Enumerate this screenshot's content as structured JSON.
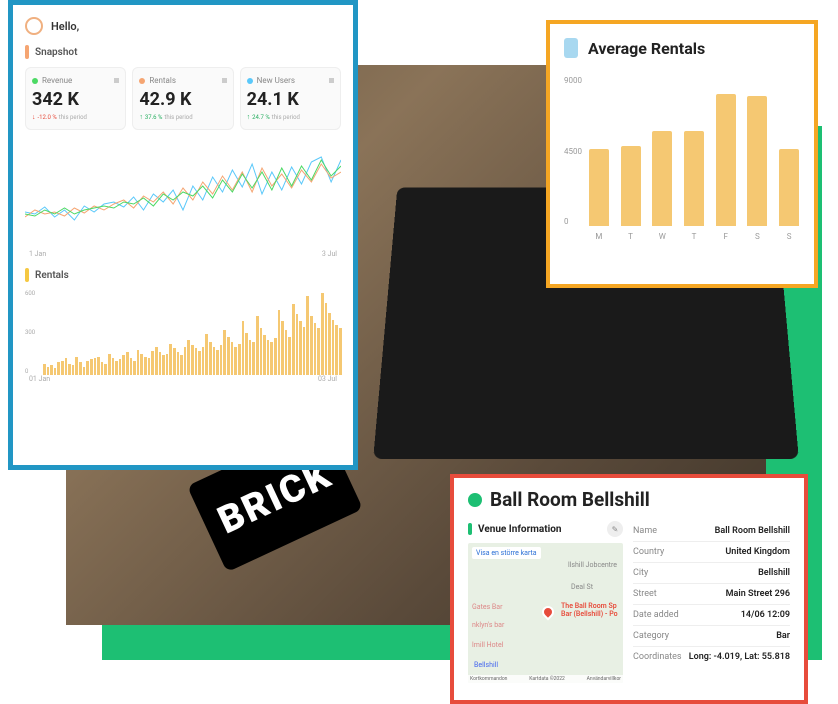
{
  "greeting": "Hello,",
  "dashboard": {
    "snapshot_label": "Snapshot",
    "rentals_section_label": "Rentals",
    "stats": [
      {
        "label": "Revenue",
        "value": "342 K",
        "change": "-12.0 %",
        "direction": "down",
        "period": "this period",
        "dot": "green"
      },
      {
        "label": "Rentals",
        "value": "42.9 K",
        "change": "37.6 %",
        "direction": "up",
        "period": "this period",
        "dot": "orange"
      },
      {
        "label": "New Users",
        "value": "24.1 K",
        "change": "24.7 %",
        "direction": "up",
        "period": "this period",
        "dot": "blue"
      }
    ],
    "line_dates": {
      "start": "1 Jan",
      "end": "3 Jul"
    },
    "rentals_dates": {
      "start": "01 Jan",
      "end": "03 Jul"
    },
    "rentals_y": [
      "600",
      "300",
      "0"
    ]
  },
  "avg": {
    "title": "Average Rentals",
    "y": [
      "9000",
      "4500",
      "0"
    ]
  },
  "venue": {
    "title": "Ball Room Bellshill",
    "info_label": "Venue Information",
    "map_link": "Visa en större karta",
    "map_pin_label": "The Ball Room Sp\nBar (Bellshill) - Po",
    "map_places": {
      "top": "llshill Jobcentre",
      "gate": "Gates Bar",
      "nklyn": "nklyn's bar",
      "hotel": "lmill Hotel",
      "bellshill": "Bellshill",
      "deal": "Deal St"
    },
    "map_attr": {
      "left": "Kortkommandon",
      "mid": "Kartdata ©2022",
      "right": "Användarvillkor"
    },
    "fields": [
      {
        "label": "Name",
        "value": "Ball Room Bellshill"
      },
      {
        "label": "Country",
        "value": "United Kingdom"
      },
      {
        "label": "City",
        "value": "Bellshill"
      },
      {
        "label": "Street",
        "value": "Main Street 296"
      },
      {
        "label": "Date added",
        "value": "14/06 12:09"
      },
      {
        "label": "Category",
        "value": "Bar"
      },
      {
        "label": "Coordinates",
        "value": "Long: -4.019, Lat: 55.818"
      }
    ]
  },
  "brick_text": "BRICK",
  "chart_data": [
    {
      "type": "bar",
      "title": "Average Rentals",
      "categories": [
        "M",
        "T",
        "W",
        "T",
        "F",
        "S",
        "S"
      ],
      "values": [
        4600,
        4800,
        5700,
        5700,
        7900,
        7800,
        4600
      ],
      "ylim": [
        0,
        9000
      ],
      "ylabel": "",
      "xlabel": ""
    },
    {
      "type": "bar",
      "title": "Rentals",
      "note": "Daily rentals bar chart Jan–Jul, approximate values",
      "x_range": [
        "01 Jan",
        "03 Jul"
      ],
      "ylim": [
        0,
        600
      ],
      "values": [
        80,
        60,
        70,
        50,
        90,
        100,
        120,
        80,
        70,
        130,
        90,
        60,
        100,
        110,
        120,
        130,
        90,
        80,
        150,
        120,
        100,
        110,
        140,
        160,
        120,
        100,
        180,
        150,
        130,
        120,
        170,
        200,
        160,
        140,
        150,
        220,
        190,
        160,
        140,
        200,
        250,
        210,
        190,
        170,
        200,
        290,
        230,
        200,
        180,
        210,
        320,
        270,
        230,
        200,
        220,
        380,
        300,
        250,
        230,
        420,
        330,
        280,
        250,
        230,
        260,
        460,
        380,
        320,
        270,
        500,
        430,
        380,
        340,
        560,
        420,
        370,
        330,
        580,
        510,
        440,
        390,
        350,
        330
      ]
    },
    {
      "type": "line",
      "title": "Snapshot trend",
      "note": "Multi-series wiggly line chart Jan–Jul, values approximate",
      "x_range": [
        "1 Jan",
        "3 Jul"
      ],
      "series": [
        {
          "name": "Revenue",
          "color": "#4cd964"
        },
        {
          "name": "Rentals",
          "color": "#f5a572"
        },
        {
          "name": "New Users",
          "color": "#5ac8fa"
        }
      ]
    }
  ]
}
